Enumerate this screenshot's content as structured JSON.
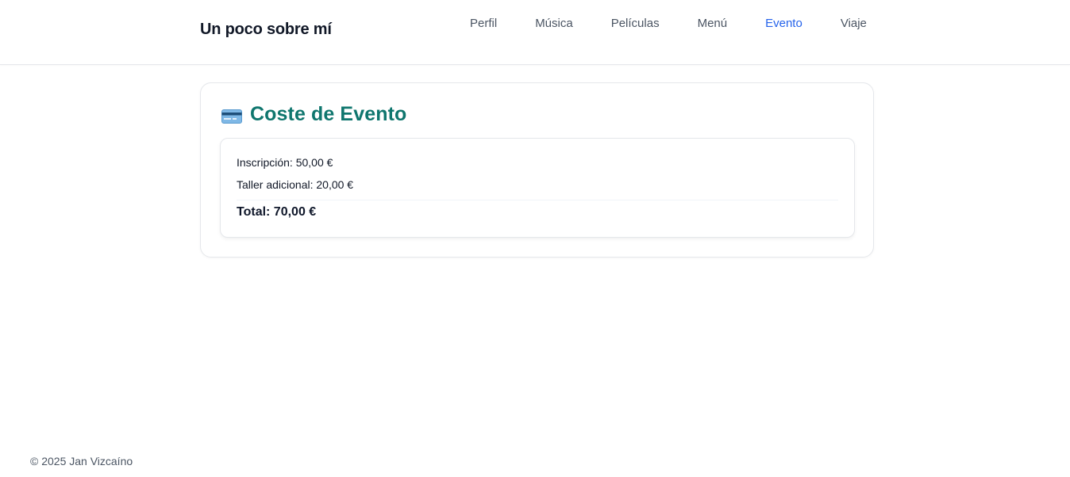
{
  "header": {
    "brand": "Un poco sobre mí",
    "nav": [
      {
        "label": "Perfil",
        "active": false
      },
      {
        "label": "Música",
        "active": false
      },
      {
        "label": "Películas",
        "active": false
      },
      {
        "label": "Menú",
        "active": false
      },
      {
        "label": "Evento",
        "active": true
      },
      {
        "label": "Viaje",
        "active": false
      }
    ]
  },
  "main": {
    "title": "Coste de Evento",
    "title_icon": "credit-card-icon",
    "title_color": "#0f766e",
    "items": [
      {
        "label": "Inscripción: 50,00 €"
      },
      {
        "label": "Taller adicional: 20,00 €"
      }
    ],
    "total": "Total: 70,00 €"
  },
  "footer": {
    "copyright": "© 2025 Jan Vizcaíno"
  },
  "colors": {
    "accent": "#2563eb",
    "brand_text": "#111827",
    "nav_text": "#4b5563"
  }
}
